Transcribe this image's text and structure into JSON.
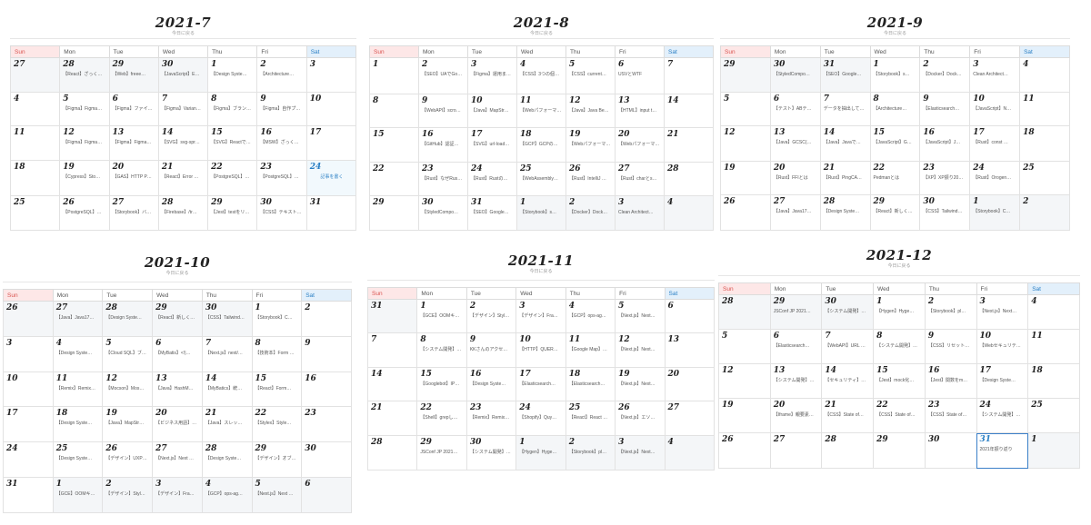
{
  "weekdays": [
    "Sun",
    "Mon",
    "Tue",
    "Wed",
    "Thu",
    "Fri",
    "Sat"
  ],
  "calendars": [
    {
      "title": "2021-7",
      "subtitle": "今日に戻る",
      "weeks": [
        [
          {
            "d": "27",
            "o": 1,
            "e": ""
          },
          {
            "d": "28",
            "o": 1,
            "e": "【React】ざっく…"
          },
          {
            "d": "29",
            "o": 1,
            "e": "【Web】freee…"
          },
          {
            "d": "30",
            "o": 1,
            "e": "【JavaScript】E…"
          },
          {
            "d": "1",
            "e": "【Design Syste…"
          },
          {
            "d": "2",
            "e": "【Architecture…"
          },
          {
            "d": "3",
            "e": ""
          }
        ],
        [
          {
            "d": "4",
            "e": ""
          },
          {
            "d": "5",
            "e": "【Figma】Figma…"
          },
          {
            "d": "6",
            "e": "【Figma】ファイ…"
          },
          {
            "d": "7",
            "e": "【Figma】Varian…"
          },
          {
            "d": "8",
            "e": "【Figma】ブラン…"
          },
          {
            "d": "9",
            "e": "【Figma】自作プ…"
          },
          {
            "d": "10",
            "e": ""
          }
        ],
        [
          {
            "d": "11",
            "e": ""
          },
          {
            "d": "12",
            "e": "【Figma】Figma…"
          },
          {
            "d": "13",
            "e": "【Figma】Figma…"
          },
          {
            "d": "14",
            "e": "【SVG】svg-spr…"
          },
          {
            "d": "15",
            "e": "【SVG】Reactで…"
          },
          {
            "d": "16",
            "e": "【MSW】ざっく…"
          },
          {
            "d": "17",
            "e": ""
          }
        ],
        [
          {
            "d": "18",
            "e": ""
          },
          {
            "d": "19",
            "e": "【Cypress】Sto…"
          },
          {
            "d": "20",
            "e": "【GAS】HTTP P…"
          },
          {
            "d": "21",
            "e": "【React】Error …"
          },
          {
            "d": "22",
            "e": "【PostgreSQL】…"
          },
          {
            "d": "23",
            "e": "【PostgreSQL】…"
          },
          {
            "d": "24",
            "t": 1,
            "e": "記事を書く"
          }
        ],
        [
          {
            "d": "25",
            "e": ""
          },
          {
            "d": "26",
            "e": "【PostgreSQL】…"
          },
          {
            "d": "27",
            "e": "【Storybook】バ…"
          },
          {
            "d": "28",
            "e": "【Firebase】/tr…"
          },
          {
            "d": "29",
            "e": "【Jest】testをリ…"
          },
          {
            "d": "30",
            "e": "【CSS】テキスト…"
          },
          {
            "d": "31",
            "e": ""
          }
        ]
      ]
    },
    {
      "title": "2021-8",
      "subtitle": "今日に戻る",
      "weeks": [
        [
          {
            "d": "1",
            "e": ""
          },
          {
            "d": "2",
            "e": "【SEO】UAでGo…"
          },
          {
            "d": "3",
            "e": "【Figma】運用ま…"
          },
          {
            "d": "4",
            "e": "【CSS】3つの個数…"
          },
          {
            "d": "5",
            "e": "【CSS】current…"
          },
          {
            "d": "6",
            "e": "USVとWTF"
          },
          {
            "d": "7",
            "e": ""
          }
        ],
        [
          {
            "d": "8",
            "e": ""
          },
          {
            "d": "9",
            "e": "【WebAPI】scro…"
          },
          {
            "d": "10",
            "e": "【Java】MapStr…"
          },
          {
            "d": "11",
            "e": "【Webパフォーマ…"
          },
          {
            "d": "12",
            "e": "【Java】Java Be…"
          },
          {
            "d": "13",
            "e": "【HTML】input t…"
          },
          {
            "d": "14",
            "e": ""
          }
        ],
        [
          {
            "d": "15",
            "e": ""
          },
          {
            "d": "16",
            "e": "【GitHub】認証…"
          },
          {
            "d": "17",
            "e": "【SVG】url-load…"
          },
          {
            "d": "18",
            "e": "【GCP】GCPの…"
          },
          {
            "d": "19",
            "e": "【Webパフォーマ…"
          },
          {
            "d": "20",
            "e": "【Webパフォーマ…"
          },
          {
            "d": "21",
            "e": ""
          }
        ],
        [
          {
            "d": "22",
            "e": ""
          },
          {
            "d": "23",
            "e": "【Rust】なぜRus…"
          },
          {
            "d": "24",
            "e": "【Rust】Rustの…"
          },
          {
            "d": "25",
            "e": "【WebAssembly…"
          },
          {
            "d": "26",
            "e": "【Rust】IntelliJ …"
          },
          {
            "d": "27",
            "e": "【Rust】charとs…"
          },
          {
            "d": "28",
            "e": ""
          }
        ],
        [
          {
            "d": "29",
            "e": ""
          },
          {
            "d": "30",
            "e": "【StyledCompo…"
          },
          {
            "d": "31",
            "e": "【SEO】Google…"
          },
          {
            "d": "1",
            "o": 1,
            "e": "【Storybook】s…"
          },
          {
            "d": "2",
            "o": 1,
            "e": "【Docker】Dock…"
          },
          {
            "d": "3",
            "o": 1,
            "e": "Clean Architect…"
          },
          {
            "d": "4",
            "o": 1,
            "e": ""
          }
        ]
      ]
    },
    {
      "title": "2021-9",
      "subtitle": "今日に戻る",
      "weeks": [
        [
          {
            "d": "29",
            "o": 1,
            "e": ""
          },
          {
            "d": "30",
            "o": 1,
            "e": "【StyledCompo…"
          },
          {
            "d": "31",
            "o": 1,
            "e": "【SEO】Google…"
          },
          {
            "d": "1",
            "e": "【Storybook】s…"
          },
          {
            "d": "2",
            "e": "【Docker】Dock…"
          },
          {
            "d": "3",
            "e": "Clean Architect…"
          },
          {
            "d": "4",
            "e": ""
          }
        ],
        [
          {
            "d": "5",
            "e": ""
          },
          {
            "d": "6",
            "e": "【テスト】ABテ…"
          },
          {
            "d": "7",
            "e": "データを抽出して…"
          },
          {
            "d": "8",
            "e": "【Architecture…"
          },
          {
            "d": "9",
            "e": "【Elasticsearch…"
          },
          {
            "d": "10",
            "e": "【JavaScript】N…"
          },
          {
            "d": "11",
            "e": ""
          }
        ],
        [
          {
            "d": "12",
            "e": ""
          },
          {
            "d": "13",
            "e": "【Java】GCSC(…"
          },
          {
            "d": "14",
            "e": "【Java】Javaで…"
          },
          {
            "d": "15",
            "e": "【JavaScript】G…"
          },
          {
            "d": "16",
            "e": "【JavaScript】J…"
          },
          {
            "d": "17",
            "e": "【Rust】const …"
          },
          {
            "d": "18",
            "e": ""
          }
        ],
        [
          {
            "d": "19",
            "e": ""
          },
          {
            "d": "20",
            "e": "【Rust】FFIとは"
          },
          {
            "d": "21",
            "e": "【Rust】PingCA…"
          },
          {
            "d": "22",
            "e": "Pedmanとは"
          },
          {
            "d": "23",
            "e": "【XP】XP振り20…"
          },
          {
            "d": "24",
            "e": "【Rust】Orogen…"
          },
          {
            "d": "25",
            "e": ""
          }
        ],
        [
          {
            "d": "26",
            "e": ""
          },
          {
            "d": "27",
            "e": "【Java】Java17…"
          },
          {
            "d": "28",
            "e": "【Design Syste…"
          },
          {
            "d": "29",
            "e": "【React】新しく…"
          },
          {
            "d": "30",
            "e": "【CSS】Tailwind…"
          },
          {
            "d": "1",
            "o": 1,
            "e": "【Storybook】C…"
          },
          {
            "d": "2",
            "o": 1,
            "e": ""
          }
        ]
      ]
    },
    {
      "title": "2021-10",
      "subtitle": "今日に戻る",
      "weeks": [
        [
          {
            "d": "26",
            "o": 1,
            "e": ""
          },
          {
            "d": "27",
            "o": 1,
            "e": "【Java】Java17…"
          },
          {
            "d": "28",
            "o": 1,
            "e": "【Design Syste…"
          },
          {
            "d": "29",
            "o": 1,
            "e": "【React】新しく…"
          },
          {
            "d": "30",
            "o": 1,
            "e": "【CSS】Tailwind…"
          },
          {
            "d": "1",
            "e": "【Storybook】C…"
          },
          {
            "d": "2",
            "e": ""
          }
        ],
        [
          {
            "d": "3",
            "e": ""
          },
          {
            "d": "4",
            "e": "【Design Syste…"
          },
          {
            "d": "5",
            "e": "【Cloud SQL】ブ…"
          },
          {
            "d": "6",
            "e": "【MyBatis】<!|…"
          },
          {
            "d": "7",
            "e": "【Next.js】next/…"
          },
          {
            "d": "8",
            "e": "【技術本】Form …"
          },
          {
            "d": "9",
            "e": ""
          }
        ],
        [
          {
            "d": "10",
            "e": ""
          },
          {
            "d": "11",
            "e": "【Remix】Remix…"
          },
          {
            "d": "12",
            "e": "【Mocson】Mos…"
          },
          {
            "d": "13",
            "e": "【Java】HashM…"
          },
          {
            "d": "14",
            "e": "【MyBatics】統…"
          },
          {
            "d": "15",
            "e": "【React】Form…"
          },
          {
            "d": "16",
            "e": ""
          }
        ],
        [
          {
            "d": "17",
            "e": ""
          },
          {
            "d": "18",
            "e": "【Design Syste…"
          },
          {
            "d": "19",
            "e": "【Java】MapStr…"
          },
          {
            "d": "20",
            "e": "【ビジネス用語】…"
          },
          {
            "d": "21",
            "e": "【Java】スレッ…"
          },
          {
            "d": "22",
            "e": "【Stylex】Style…"
          },
          {
            "d": "23",
            "e": ""
          }
        ],
        [
          {
            "d": "24",
            "e": ""
          },
          {
            "d": "25",
            "e": "【Design Syste…"
          },
          {
            "d": "26",
            "e": "【デザイン】UXP…"
          },
          {
            "d": "27",
            "e": "【Next.js】Next …"
          },
          {
            "d": "28",
            "e": "【Design Syste…"
          },
          {
            "d": "29",
            "e": "【デザイン】オブ…"
          },
          {
            "d": "30",
            "e": ""
          }
        ],
        [
          {
            "d": "31",
            "e": ""
          },
          {
            "d": "1",
            "o": 1,
            "e": "【GCE】OOMキ…"
          },
          {
            "d": "2",
            "o": 1,
            "e": "【デザイン】Styl…"
          },
          {
            "d": "3",
            "o": 1,
            "e": "【デザイン】Fra…"
          },
          {
            "d": "4",
            "o": 1,
            "e": "【GCP】ops-ag…"
          },
          {
            "d": "5",
            "o": 1,
            "e": "【Next.js】Next …"
          },
          {
            "d": "6",
            "o": 1,
            "e": ""
          }
        ]
      ]
    },
    {
      "title": "2021-11",
      "subtitle": "今日に戻る",
      "weeks": [
        [
          {
            "d": "31",
            "o": 1,
            "e": ""
          },
          {
            "d": "1",
            "e": "【GCE】OOMキ…"
          },
          {
            "d": "2",
            "e": "【デザイン】Styl…"
          },
          {
            "d": "3",
            "e": "【デザイン】Fra…"
          },
          {
            "d": "4",
            "e": "【GCP】ops-ag…"
          },
          {
            "d": "5",
            "e": "【Next.js】Next…"
          },
          {
            "d": "6",
            "e": ""
          }
        ],
        [
          {
            "d": "7",
            "e": ""
          },
          {
            "d": "8",
            "e": "【システム開発】…"
          },
          {
            "d": "9",
            "e": "KKさんのアクセ…"
          },
          {
            "d": "10",
            "e": "【HTTP】QUER…"
          },
          {
            "d": "11",
            "e": "【Google Map】…"
          },
          {
            "d": "12",
            "e": "【Next.js】Next…"
          },
          {
            "d": "13",
            "e": ""
          }
        ],
        [
          {
            "d": "14",
            "e": ""
          },
          {
            "d": "15",
            "e": "【Googlebot】IP…"
          },
          {
            "d": "16",
            "e": "【Design Syste…"
          },
          {
            "d": "17",
            "e": "【Elasticsearch…"
          },
          {
            "d": "18",
            "e": "【Elasticsearch…"
          },
          {
            "d": "19",
            "e": "【Next.js】Next…"
          },
          {
            "d": "20",
            "e": ""
          }
        ],
        [
          {
            "d": "21",
            "e": ""
          },
          {
            "d": "22",
            "e": "【Shell】grepし…"
          },
          {
            "d": "23",
            "e": "【Remix】Remix…"
          },
          {
            "d": "24",
            "e": "【Shopify】Quy…"
          },
          {
            "d": "25",
            "e": "【React】React …"
          },
          {
            "d": "26",
            "e": "【Next.js】エソ…"
          },
          {
            "d": "27",
            "e": ""
          }
        ],
        [
          {
            "d": "28",
            "e": ""
          },
          {
            "d": "29",
            "e": "JSConf JP 2021…"
          },
          {
            "d": "30",
            "e": "【システム開発】…"
          },
          {
            "d": "1",
            "o": 1,
            "e": "【Hygen】Hyge…"
          },
          {
            "d": "2",
            "o": 1,
            "e": "【Storybook】pl…"
          },
          {
            "d": "3",
            "o": 1,
            "e": "【Next.js】Next…"
          },
          {
            "d": "4",
            "o": 1,
            "e": ""
          }
        ]
      ]
    },
    {
      "title": "2021-12",
      "subtitle": "今日に戻る",
      "weeks": [
        [
          {
            "d": "28",
            "o": 1,
            "e": ""
          },
          {
            "d": "29",
            "o": 1,
            "e": "JSConf JP 2021…"
          },
          {
            "d": "30",
            "o": 1,
            "e": "【システム開発】…"
          },
          {
            "d": "1",
            "e": "【Hygen】Hyge…"
          },
          {
            "d": "2",
            "e": "【Storybook】pl…"
          },
          {
            "d": "3",
            "e": "【Next.js】Next…"
          },
          {
            "d": "4",
            "e": ""
          }
        ],
        [
          {
            "d": "5",
            "e": ""
          },
          {
            "d": "6",
            "e": "【Elasticsearch…"
          },
          {
            "d": "7",
            "e": "【WebAPI】URL …"
          },
          {
            "d": "8",
            "e": "【システム開発】…"
          },
          {
            "d": "9",
            "e": "【CSS】リセット…"
          },
          {
            "d": "10",
            "e": "【Webセキュリテ…"
          },
          {
            "d": "11",
            "e": ""
          }
        ],
        [
          {
            "d": "12",
            "e": ""
          },
          {
            "d": "13",
            "e": "【システム開発】…"
          },
          {
            "d": "14",
            "e": "【セキュリティ】…"
          },
          {
            "d": "15",
            "e": "【Jest】mock化…"
          },
          {
            "d": "16",
            "e": "【Jest】関数をm…"
          },
          {
            "d": "17",
            "e": "【Design Syste…"
          },
          {
            "d": "18",
            "e": ""
          }
        ],
        [
          {
            "d": "19",
            "e": ""
          },
          {
            "d": "20",
            "e": "【Iframe】親要素…"
          },
          {
            "d": "21",
            "e": "【CSS】State of…"
          },
          {
            "d": "22",
            "e": "【CSS】State of…"
          },
          {
            "d": "23",
            "e": "【CSS】State of…"
          },
          {
            "d": "24",
            "e": "【システム開発】…"
          },
          {
            "d": "25",
            "e": ""
          }
        ],
        [
          {
            "d": "26",
            "e": ""
          },
          {
            "d": "27",
            "e": ""
          },
          {
            "d": "28",
            "e": ""
          },
          {
            "d": "29",
            "e": ""
          },
          {
            "d": "30",
            "e": ""
          },
          {
            "d": "31",
            "t": 2,
            "e": "2021年振り返り"
          },
          {
            "d": "1",
            "o": 1,
            "e": ""
          }
        ]
      ]
    }
  ]
}
